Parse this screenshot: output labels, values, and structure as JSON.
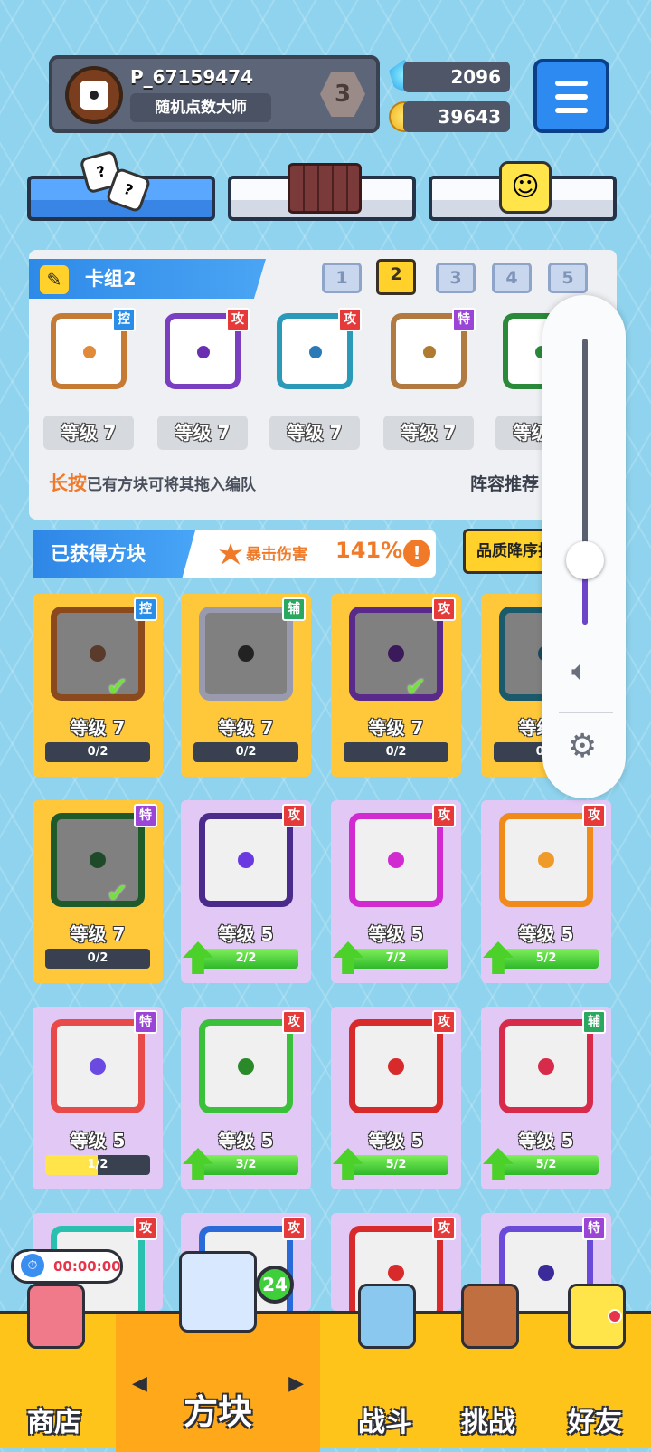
{
  "profile": {
    "name": "P_67159474",
    "title": "随机点数大师",
    "rank": "3"
  },
  "currency": {
    "gems": "2096",
    "coins": "39643"
  },
  "deck": {
    "title": "卡组2",
    "slots": [
      "1",
      "2",
      "3",
      "4",
      "5"
    ],
    "active_slot": "2",
    "cards": [
      {
        "level": "等级 7",
        "badge": "控",
        "badge_type": "control",
        "frame": "#c67b35",
        "dot": "#e08a3a"
      },
      {
        "level": "等级 7",
        "badge": "攻",
        "badge_type": "attack",
        "frame": "#7a3fc0",
        "dot": "#6a2fb0"
      },
      {
        "level": "等级 7",
        "badge": "攻",
        "badge_type": "attack",
        "frame": "#2a9ab8",
        "dot": "#2a7ab8"
      },
      {
        "level": "等级 7",
        "badge": "特",
        "badge_type": "special",
        "frame": "#b07a40",
        "dot": "#b07a30"
      },
      {
        "level": "等级 7",
        "badge": "",
        "badge_type": "",
        "frame": "#2a8a3a",
        "dot": "#2a8a3a"
      }
    ],
    "hint_highlight": "长按",
    "hint_text": "已有方块可将其拖入编队",
    "recommend": "阵容推荐"
  },
  "obtained": {
    "title": "已获得方块",
    "crit_label": "暴击伤害",
    "crit_value": "141%",
    "warn": "!",
    "quality_button": "品质降序排序"
  },
  "cards": [
    {
      "kind": "gold",
      "level": "等级 7",
      "progress": "0/2",
      "badge": "控",
      "badge_type": "control",
      "frame": "#8a4a1e",
      "dot": "#5a3a2a",
      "owned": true,
      "upgrade": false
    },
    {
      "kind": "gold",
      "level": "等级 7",
      "progress": "0/2",
      "badge": "辅",
      "badge_type": "support",
      "frame": "#9a9aae",
      "dot": "#222222",
      "owned": false,
      "upgrade": false
    },
    {
      "kind": "gold",
      "level": "等级 7",
      "progress": "0/2",
      "badge": "攻",
      "badge_type": "attack",
      "frame": "#5a2a8a",
      "dot": "#3a1a5a",
      "owned": true,
      "upgrade": false
    },
    {
      "kind": "gold",
      "level": "等级 7",
      "progress": "0/2",
      "badge": "攻",
      "badge_type": "attack",
      "frame": "#1a5a6a",
      "dot": "#1a4a5a",
      "owned": false,
      "upgrade": false
    },
    {
      "kind": "gold",
      "level": "等级 7",
      "progress": "0/2",
      "badge": "特",
      "badge_type": "special",
      "frame": "#1e5a2a",
      "dot": "#1e4a2a",
      "owned": true,
      "upgrade": false
    },
    {
      "kind": "purple",
      "level": "等级 5",
      "progress": "2/2",
      "badge": "攻",
      "badge_type": "attack",
      "frame": "#4a2a8a",
      "dot": "#6a3ae0",
      "owned": false,
      "upgrade": true
    },
    {
      "kind": "purple",
      "level": "等级 5",
      "progress": "7/2",
      "badge": "攻",
      "badge_type": "attack",
      "frame": "#d02ad0",
      "dot": "#d02ad0",
      "owned": false,
      "upgrade": true
    },
    {
      "kind": "purple",
      "level": "等级 5",
      "progress": "5/2",
      "badge": "攻",
      "badge_type": "attack",
      "frame": "#f08a1a",
      "dot": "#f09a2a",
      "owned": false,
      "upgrade": true
    },
    {
      "kind": "purple",
      "level": "等级 5",
      "progress": "1/2",
      "badge": "特",
      "badge_type": "special",
      "frame": "#e84a4a",
      "dot": "#6a4ae0",
      "owned": false,
      "upgrade": false
    },
    {
      "kind": "purple",
      "level": "等级 5",
      "progress": "3/2",
      "badge": "攻",
      "badge_type": "attack",
      "frame": "#3ac03a",
      "dot": "#2a8a2a",
      "owned": false,
      "upgrade": true
    },
    {
      "kind": "purple",
      "level": "等级 5",
      "progress": "5/2",
      "badge": "攻",
      "badge_type": "attack",
      "frame": "#d82a2a",
      "dot": "#d82a2a",
      "owned": false,
      "upgrade": true
    },
    {
      "kind": "purple",
      "level": "等级 5",
      "progress": "5/2",
      "badge": "辅",
      "badge_type": "support",
      "frame": "#d82a4a",
      "dot": "#d82a4a",
      "owned": false,
      "upgrade": true
    },
    {
      "kind": "purple",
      "level": "",
      "progress": "",
      "badge": "攻",
      "badge_type": "attack",
      "frame": "#2ac0b0",
      "dot": "#2ac0b0",
      "owned": false,
      "upgrade": false
    },
    {
      "kind": "purple",
      "level": "",
      "progress": "",
      "badge": "攻",
      "badge_type": "attack",
      "frame": "#2a6ad8",
      "dot": "#2a6ad8",
      "owned": false,
      "upgrade": false
    },
    {
      "kind": "purple",
      "level": "",
      "progress": "",
      "badge": "攻",
      "badge_type": "attack",
      "frame": "#d82a2a",
      "dot": "#d82a2a",
      "owned": false,
      "upgrade": false
    },
    {
      "kind": "purple",
      "level": "",
      "progress": "",
      "badge": "特",
      "badge_type": "special",
      "frame": "#6a4ad8",
      "dot": "#3a2a9a",
      "owned": false,
      "upgrade": false
    }
  ],
  "volume": {
    "level_percent": 23
  },
  "timer": "00:00:00",
  "nav": {
    "shop": "商店",
    "blocks": "方块",
    "battle": "战斗",
    "challenge": "挑战",
    "friends": "好友",
    "block_count": "24"
  },
  "icons": {
    "gem": "gem-icon",
    "coin": "coin-icon",
    "menu": "menu-icon",
    "speaker": "speaker-icon",
    "settings": "settings-icon"
  }
}
